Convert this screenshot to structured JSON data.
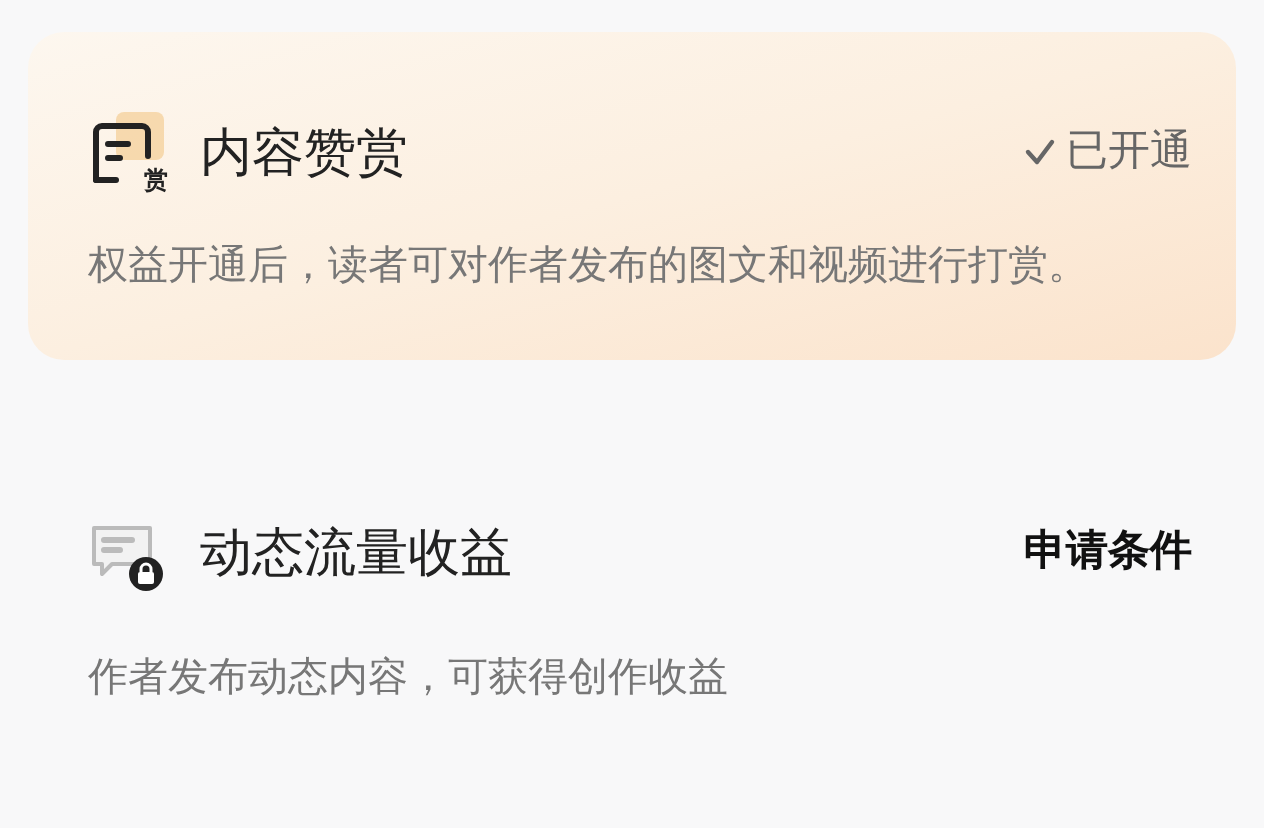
{
  "items": [
    {
      "title": "内容赞赏",
      "icon_badge": "赏",
      "unlocked": true,
      "status": "已开通",
      "description": "权益开通后，读者可对作者发布的图文和视频进行打赏。"
    },
    {
      "title": "动态流量收益",
      "unlocked": false,
      "status": "申请条件",
      "description": "作者发布动态内容，可获得创作收益"
    }
  ]
}
